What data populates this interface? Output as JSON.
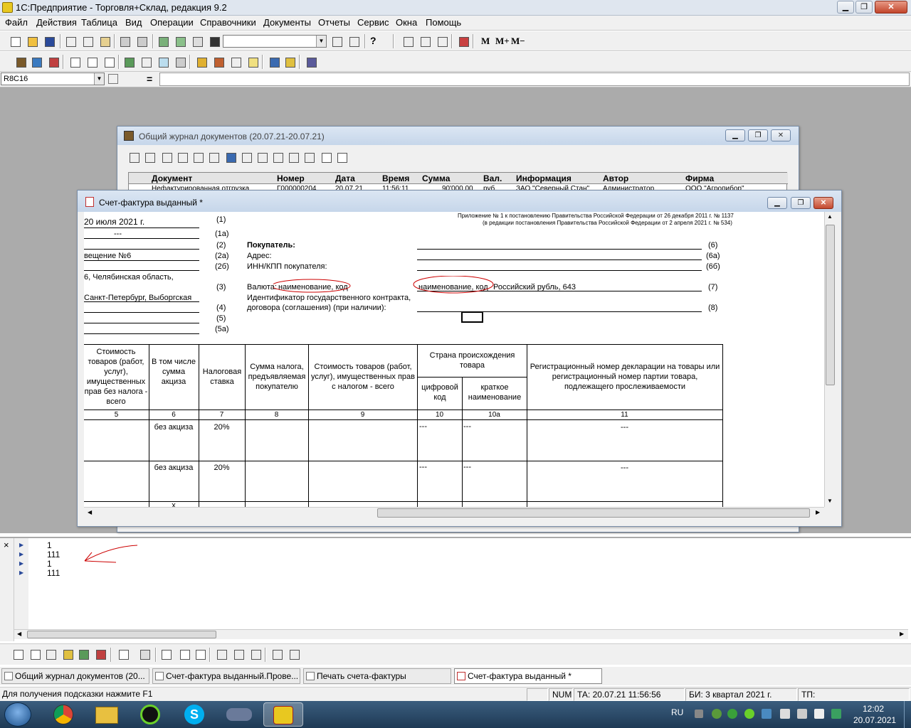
{
  "app": {
    "title": "1С:Предприятие - Торговля+Склад, редакция 9.2",
    "min": "▁",
    "max": "❐",
    "close": "✕"
  },
  "menu": [
    "Файл",
    "Действия",
    "Таблица",
    "Вид",
    "Операции",
    "Справочники",
    "Документы",
    "Отчеты",
    "Сервис",
    "Окна",
    "Помощь"
  ],
  "toolbar": {
    "memory_buttons": [
      "M",
      "M+",
      "M−"
    ],
    "help": "?",
    "search_value": ""
  },
  "formula": {
    "cell_ref": "R8C16",
    "equals": "="
  },
  "journal": {
    "title": "Общий журнал документов (20.07.21-20.07.21)",
    "columns": [
      "Документ",
      "Номер",
      "Дата",
      "Время",
      "Сумма",
      "Вал.",
      "Информация",
      "Автор",
      "Фирма"
    ],
    "row": [
      "Нефактурированная отгрузка",
      "Г000000204",
      "20.07.21",
      "11:56:11",
      "90'000,00",
      "руб.",
      "ЗАО \"Северный Стан\"",
      "Администратор",
      "ООО \"Агропибор\""
    ]
  },
  "invoice": {
    "title": "Счет-фактура выданный  *",
    "appendix1": "Приложение № 1 к постановлению Правительства Российской Федерации от 26 декабря 2011 г. № 1137",
    "appendix2": "(в редакции постановления Правительства Российской Федерации от 2 апреля 2021 г. № 534)",
    "left": {
      "date": "20 июля 2021 г.",
      "corr": "---",
      "room": "вещение №6",
      "addr1": "6, Челябинская область,",
      "addr2": "Санкт-Петербург, Выборгская"
    },
    "left_codes": [
      "(1)",
      "(1а)",
      "(2)",
      "(2а)",
      "(2б)",
      "(3)",
      "(4)",
      "(5)",
      "(5а)"
    ],
    "buyer_label": "Покупатель:",
    "address_label": "Адрес:",
    "inn_label": "ИНН/КПП покупателя:",
    "currency_label": "Валюта:",
    "currency_hint": "наименование, код",
    "currency_hint2": "наименование, код",
    "currency_value": "Российский рубль, 643",
    "contract_label1": "Идентификатор государственного контракта,",
    "contract_label2": "договора (соглашения) (при наличии):",
    "right_codes": [
      "(6)",
      "(6а)",
      "(6б)",
      "(7)",
      "(8)"
    ],
    "headers": {
      "c5": "Стоимость товаров (работ, услуг), имущественных прав без налога - всего",
      "c6": "В том числе сумма акциза",
      "c7": "Налоговая ставка",
      "c8": "Сумма налога, предъявляемая покупателю",
      "c9": "Стоимость товаров (работ, услуг), имущественных прав с налогом - всего",
      "c10g": "Страна происхождения товара",
      "c10": "цифровой код",
      "c10a": "краткое наименование",
      "c11": "Регистрационный номер декларации на товары или регистрационный номер партии товара, подлежащего прослеживаемости"
    },
    "col_numbers": [
      "5",
      "6",
      "7",
      "8",
      "9",
      "10",
      "10а",
      "11"
    ],
    "rows": [
      {
        "excise": "без акциза",
        "rate": "20%",
        "code": "---",
        "name": "---",
        "decl": "---"
      },
      {
        "excise": "без акциза",
        "rate": "20%",
        "code": "---",
        "name": "---",
        "decl": "---"
      }
    ],
    "bottom_mark": "х"
  },
  "messages": {
    "lines": [
      "1",
      "111",
      "1",
      "111"
    ],
    "close": "×"
  },
  "windows": [
    "Общий журнал документов (20...",
    "Счет-фактура выданный.Прове...",
    "Печать счета-фактуры",
    "Счет-фактура выданный  *"
  ],
  "status": {
    "hint": "Для получения подсказки нажмите F1",
    "num": "NUM",
    "ta": "ТА: 20.07.21  11:56:56",
    "bi": "БИ: 3 квартал 2021 г.",
    "tp": "ТП:"
  },
  "taskbar": {
    "lang": "RU",
    "time": "12:02",
    "date": "20.07.2021"
  },
  "colors": {
    "workspace": "#ababab",
    "title_gradient": "#c6d6ea",
    "annotation": "#cc0000",
    "taskbar": "#1e3a55"
  }
}
